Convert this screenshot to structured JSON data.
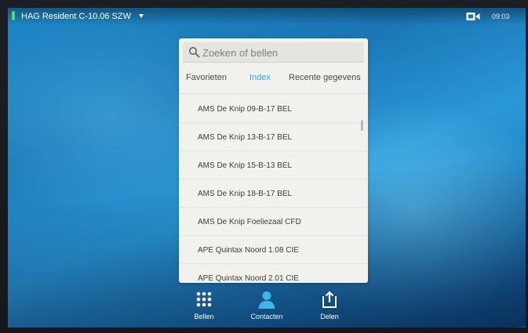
{
  "topbar": {
    "device_name": "HAG Resident C-10.06 SZW",
    "time": "09:03",
    "status_color": "#5fd35a",
    "icons": [
      "chevron-down-icon",
      "camera-icon"
    ]
  },
  "phonebook": {
    "search": {
      "placeholder": "Zoeken of bellen"
    },
    "tabs": [
      {
        "label": "Favorieten",
        "active": false
      },
      {
        "label": "Index",
        "active": true
      },
      {
        "label": "Recente gegevens",
        "active": false
      }
    ],
    "accent_color": "#34a8d8",
    "entries": [
      "AMS De Knip 09-B-17 BEL",
      "AMS De Knip 13-B-17 BEL",
      "AMS De Knip 15-B-13 BEL",
      "AMS De Knip 18-B-17 BEL",
      "AMS De Knip Foeliezaal CFD",
      "APE Quintax Noord 1.08 CIE",
      "APE Quintax Noord 2.01 CIE"
    ]
  },
  "bottombar": {
    "buttons": [
      {
        "label": "Bellen",
        "icon": "keypad-icon"
      },
      {
        "label": "Contacten",
        "icon": "contacts-icon"
      },
      {
        "label": "Delen",
        "icon": "share-icon"
      }
    ]
  }
}
